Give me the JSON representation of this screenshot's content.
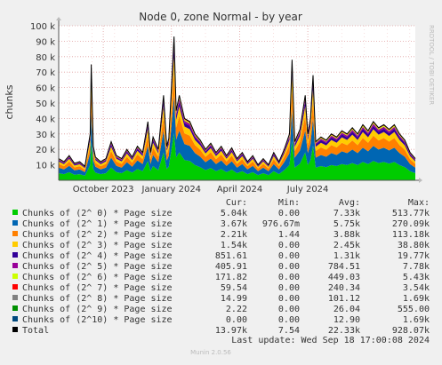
{
  "chart_data": {
    "type": "area",
    "title": "Node 0, zone Normal - by year",
    "ylabel": "chunks",
    "side_label": "RRDTOOL / TOBI OETIKER",
    "ylim": [
      0,
      100000
    ],
    "yticks": [
      {
        "value": 10000,
        "label": "10 k"
      },
      {
        "value": 20000,
        "label": "20 k"
      },
      {
        "value": 30000,
        "label": "30 k"
      },
      {
        "value": 40000,
        "label": "40 k"
      },
      {
        "value": 50000,
        "label": "50 k"
      },
      {
        "value": 60000,
        "label": "60 k"
      },
      {
        "value": 70000,
        "label": "70 k"
      },
      {
        "value": 80000,
        "label": "80 k"
      },
      {
        "value": 90000,
        "label": "90 k"
      },
      {
        "value": 100000,
        "label": "100 k"
      }
    ],
    "xticks": [
      "October 2023",
      "January 2024",
      "April 2024",
      "July 2024"
    ],
    "column_headers": [
      "Cur:",
      "Min:",
      "Avg:",
      "Max:"
    ],
    "series": [
      {
        "name": "Chunks of (2^ 0) * Page size",
        "color": "#00cc00",
        "cur": "5.04k",
        "min": "0.00",
        "avg": "7.33k",
        "max": "513.77k"
      },
      {
        "name": "Chunks of (2^ 1) * Page size",
        "color": "#0066b3",
        "cur": "3.67k",
        "min": "976.67m",
        "avg": "5.75k",
        "max": "270.09k"
      },
      {
        "name": "Chunks of (2^ 2) * Page size",
        "color": "#ff8000",
        "cur": "2.21k",
        "min": "1.44",
        "avg": "3.88k",
        "max": "113.18k"
      },
      {
        "name": "Chunks of (2^ 3) * Page size",
        "color": "#ffcc00",
        "cur": "1.54k",
        "min": "0.00",
        "avg": "2.45k",
        "max": "38.80k"
      },
      {
        "name": "Chunks of (2^ 4) * Page size",
        "color": "#330099",
        "cur": "851.61",
        "min": "0.00",
        "avg": "1.31k",
        "max": "19.77k"
      },
      {
        "name": "Chunks of (2^ 5) * Page size",
        "color": "#990099",
        "cur": "405.91",
        "min": "0.00",
        "avg": "784.51",
        "max": "7.78k"
      },
      {
        "name": "Chunks of (2^ 6) * Page size",
        "color": "#ccff00",
        "cur": "171.82",
        "min": "0.00",
        "avg": "449.03",
        "max": "5.43k"
      },
      {
        "name": "Chunks of (2^ 7) * Page size",
        "color": "#ff0000",
        "cur": "59.54",
        "min": "0.00",
        "avg": "240.34",
        "max": "3.54k"
      },
      {
        "name": "Chunks of (2^ 8) * Page size",
        "color": "#808080",
        "cur": "14.99",
        "min": "0.00",
        "avg": "101.12",
        "max": "1.69k"
      },
      {
        "name": "Chunks of (2^ 9) * Page size",
        "color": "#008f00",
        "cur": "2.22",
        "min": "0.00",
        "avg": "26.04",
        "max": "555.00"
      },
      {
        "name": "Chunks of (2^10) * Page size",
        "color": "#00487d",
        "cur": "0.00",
        "min": "0.00",
        "avg": "12.90",
        "max": "1.69k"
      },
      {
        "name": "Total",
        "color": "#000000",
        "cur": "13.97k",
        "min": "7.54",
        "avg": "22.33k",
        "max": "928.07k"
      }
    ],
    "total_profile": [
      {
        "week": 0,
        "total": 14000
      },
      {
        "week": 1,
        "total": 12000
      },
      {
        "week": 2,
        "total": 16000
      },
      {
        "week": 3,
        "total": 11000
      },
      {
        "week": 4,
        "total": 12000
      },
      {
        "week": 5,
        "total": 9000
      },
      {
        "week": 6,
        "total": 30000
      },
      {
        "week": 6.2,
        "total": 75000
      },
      {
        "week": 6.6,
        "total": 22000
      },
      {
        "week": 7,
        "total": 15000
      },
      {
        "week": 8,
        "total": 12000
      },
      {
        "week": 9,
        "total": 14000
      },
      {
        "week": 10,
        "total": 25000
      },
      {
        "week": 11,
        "total": 16000
      },
      {
        "week": 12,
        "total": 14000
      },
      {
        "week": 13,
        "total": 20000
      },
      {
        "week": 14,
        "total": 15000
      },
      {
        "week": 15,
        "total": 22000
      },
      {
        "week": 16,
        "total": 18000
      },
      {
        "week": 17,
        "total": 38000
      },
      {
        "week": 17.5,
        "total": 18000
      },
      {
        "week": 18,
        "total": 28000
      },
      {
        "week": 19,
        "total": 20000
      },
      {
        "week": 20,
        "total": 55000
      },
      {
        "week": 20.6,
        "total": 22000
      },
      {
        "week": 21,
        "total": 27000
      },
      {
        "week": 22,
        "total": 93000
      },
      {
        "week": 22.4,
        "total": 45000
      },
      {
        "week": 23,
        "total": 55000
      },
      {
        "week": 24,
        "total": 40000
      },
      {
        "week": 25,
        "total": 38000
      },
      {
        "week": 26,
        "total": 30000
      },
      {
        "week": 27,
        "total": 26000
      },
      {
        "week": 28,
        "total": 20000
      },
      {
        "week": 29,
        "total": 24000
      },
      {
        "week": 30,
        "total": 18000
      },
      {
        "week": 31,
        "total": 22000
      },
      {
        "week": 32,
        "total": 16000
      },
      {
        "week": 33,
        "total": 21000
      },
      {
        "week": 34,
        "total": 14000
      },
      {
        "week": 35,
        "total": 18000
      },
      {
        "week": 36,
        "total": 12000
      },
      {
        "week": 37,
        "total": 16000
      },
      {
        "week": 38,
        "total": 10000
      },
      {
        "week": 39,
        "total": 14000
      },
      {
        "week": 40,
        "total": 10000
      },
      {
        "week": 41,
        "total": 18000
      },
      {
        "week": 42,
        "total": 12000
      },
      {
        "week": 43,
        "total": 20000
      },
      {
        "week": 44,
        "total": 30000
      },
      {
        "week": 44.5,
        "total": 78000
      },
      {
        "week": 45,
        "total": 25000
      },
      {
        "week": 46,
        "total": 33000
      },
      {
        "week": 47,
        "total": 55000
      },
      {
        "week": 47.5,
        "total": 30000
      },
      {
        "week": 48,
        "total": 40000
      },
      {
        "week": 48.5,
        "total": 68000
      },
      {
        "week": 49,
        "total": 25000
      },
      {
        "week": 50,
        "total": 28000
      },
      {
        "week": 51,
        "total": 26000
      },
      {
        "week": 52,
        "total": 30000
      },
      {
        "week": 53,
        "total": 28000
      },
      {
        "week": 54,
        "total": 32000
      },
      {
        "week": 55,
        "total": 30000
      },
      {
        "week": 56,
        "total": 34000
      },
      {
        "week": 57,
        "total": 30000
      },
      {
        "week": 58,
        "total": 36000
      },
      {
        "week": 59,
        "total": 32000
      },
      {
        "week": 60,
        "total": 38000
      },
      {
        "week": 61,
        "total": 34000
      },
      {
        "week": 62,
        "total": 36000
      },
      {
        "week": 63,
        "total": 33000
      },
      {
        "week": 64,
        "total": 36000
      },
      {
        "week": 65,
        "total": 30000
      },
      {
        "week": 66,
        "total": 26000
      },
      {
        "week": 67,
        "total": 18000
      },
      {
        "week": 68,
        "total": 14000
      }
    ]
  },
  "footer": {
    "last_update": "Last update: Wed Sep 18 17:00:08 2024",
    "version": "Munin 2.0.56"
  }
}
